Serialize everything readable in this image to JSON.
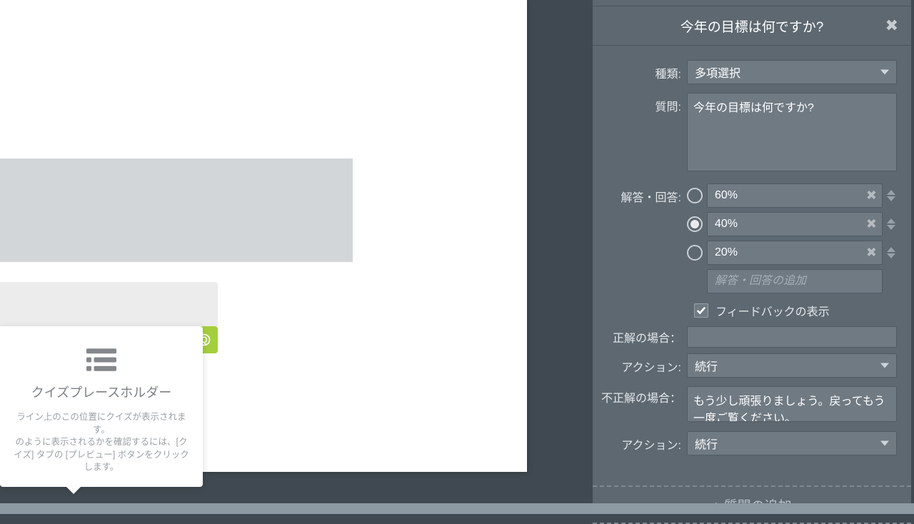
{
  "canvas": {
    "quiz_placeholder": {
      "title": "クイズプレースホルダー",
      "desc": "ライン上のこの位置にクイズが表示されます。\nのように表示されるかを確認するには、[クイズ] タブの [プレビュー] ボタンをクリックします。"
    }
  },
  "panel": {
    "header": "今年の目標は何ですか?",
    "labels": {
      "type": "種類:",
      "question": "質問:",
      "answers": "解答・回答:",
      "feedback": "フィードバックの表示",
      "correct": "正解の場合：",
      "action": "アクション:",
      "incorrect": "不正解の場合：",
      "add_answer_ph": "解答・回答の追加",
      "add_question": "+ 質問の追加"
    },
    "type_value": "多項選択",
    "question_value": "今年の目標は何ですか?",
    "answers": [
      {
        "text": "60%",
        "checked": false
      },
      {
        "text": "40%",
        "checked": true
      },
      {
        "text": "20%",
        "checked": false
      }
    ],
    "feedback_checked": true,
    "correct_text": "",
    "correct_action": "続行",
    "incorrect_text": "もう少し頑張りましょう。戻ってもう一度ご覧ください。",
    "incorrect_action": "続行"
  }
}
